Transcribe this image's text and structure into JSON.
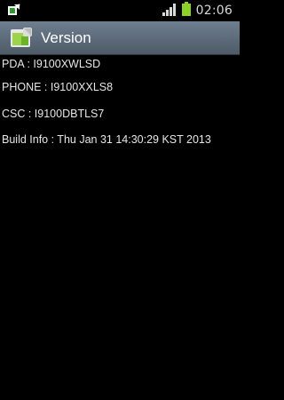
{
  "status_bar": {
    "time": "02:06",
    "icons": [
      "notification-icon",
      "signal-icon",
      "battery-icon"
    ]
  },
  "app_bar": {
    "title": "Version",
    "icon": "android-settings-icon"
  },
  "info": [
    "PDA : I9100XWLSD",
    "PHONE : I9100XXLS8",
    "CSC : I9100DBTLS7",
    "Build Info : Thu Jan 31 14:30:29 KST 2013"
  ],
  "colors": {
    "background": "#000000",
    "app_bar": "#5e6c7a",
    "battery": "#8cd02b",
    "text": "#e6e6e6"
  }
}
